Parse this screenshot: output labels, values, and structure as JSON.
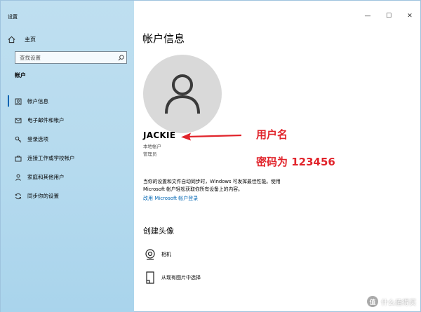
{
  "window": {
    "title": "设置"
  },
  "title_bar": {
    "minimize_glyph": "—",
    "maximize_glyph": "☐",
    "close_glyph": "✕"
  },
  "sidebar": {
    "home": {
      "label": "主页",
      "icon": "home-icon"
    },
    "search": {
      "placeholder": "查找设置",
      "icon": "search-icon"
    },
    "section_title": "帐户",
    "items": [
      {
        "label": "帐户信息",
        "icon": "account-info-icon",
        "active": true
      },
      {
        "label": "电子邮件和帐户",
        "icon": "email-icon",
        "active": false
      },
      {
        "label": "登录选项",
        "icon": "key-icon",
        "active": false
      },
      {
        "label": "连接工作或学校帐户",
        "icon": "briefcase-icon",
        "active": false
      },
      {
        "label": "家庭和其他用户",
        "icon": "person-icon",
        "active": false
      },
      {
        "label": "同步你的设置",
        "icon": "sync-icon",
        "active": false
      }
    ]
  },
  "main": {
    "page_title": "帐户信息",
    "username": "JACKIE",
    "account_type": "本地帐户",
    "account_role": "管理员",
    "description_line1": "当你的设置和文件自动同步时，Windows 可发挥最佳性能。使用",
    "description_line2": "Microsoft 帐户轻松获取你所有设备上的内容。",
    "link_label": "改用 Microsoft 帐户登录",
    "create_avatar_title": "创建头像",
    "options": [
      {
        "label": "相机",
        "icon": "camera-icon"
      },
      {
        "label": "从现有图片中选择",
        "icon": "browse-image-icon"
      }
    ]
  },
  "annotations": {
    "username_note": "用户名",
    "password_note": "密码为 123456",
    "color": "#e1242b"
  },
  "watermark": {
    "badge": "值",
    "text": "什么值得买"
  }
}
